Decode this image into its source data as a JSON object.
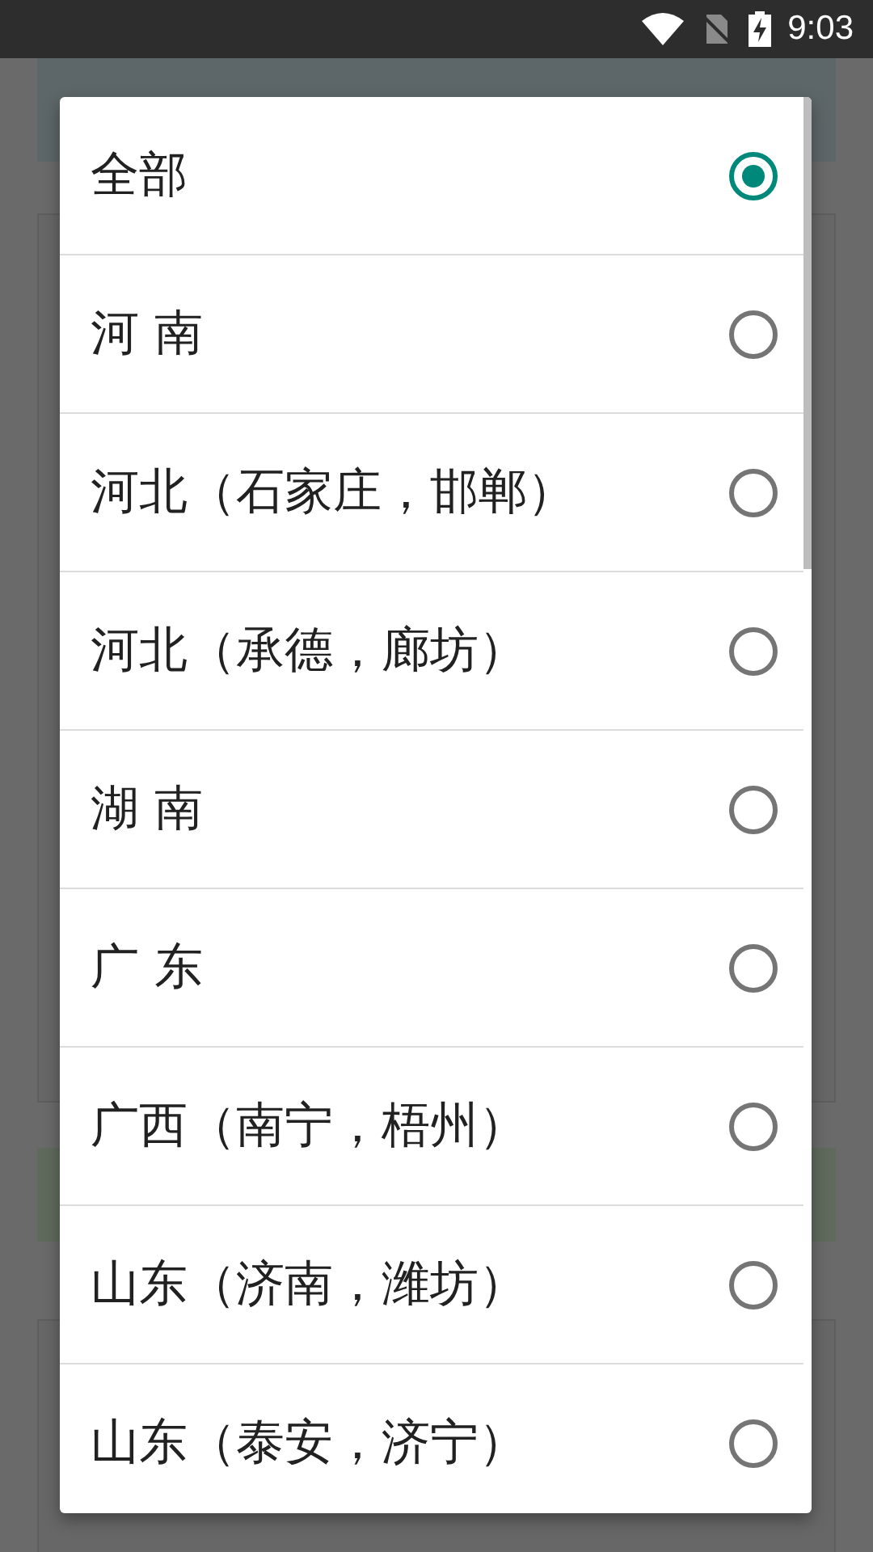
{
  "status_bar": {
    "time": "9:03"
  },
  "dialog": {
    "options": [
      {
        "label": "全部",
        "selected": true
      },
      {
        "label": "河 南",
        "selected": false
      },
      {
        "label": "河北（石家庄，邯郸）",
        "selected": false
      },
      {
        "label": "河北（承德，廊坊）",
        "selected": false
      },
      {
        "label": "湖 南",
        "selected": false
      },
      {
        "label": "广 东",
        "selected": false
      },
      {
        "label": "广西（南宁，梧州）",
        "selected": false
      },
      {
        "label": "山东（济南，潍坊）",
        "selected": false
      },
      {
        "label": "山东（泰安，济宁）",
        "selected": false
      }
    ]
  }
}
